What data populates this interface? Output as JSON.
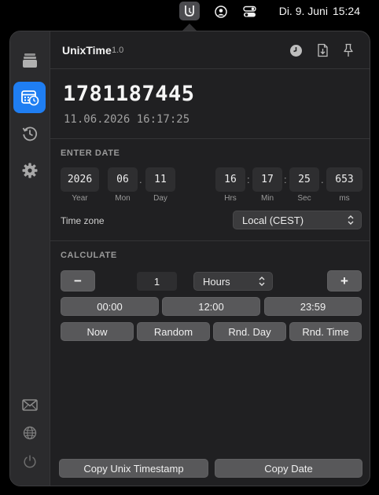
{
  "menubar": {
    "date": "Di. 9. Juni",
    "time": "15:24",
    "icons": [
      "unixtime-app-icon",
      "user-circle-icon",
      "control-center-icon"
    ]
  },
  "header": {
    "app_name": "UnixTime",
    "version": "1.0",
    "icons": [
      "clock-icon",
      "export-file-icon",
      "pin-icon"
    ]
  },
  "sidebar": {
    "items": [
      "layers-icon",
      "calendar-clock-icon",
      "history-icon",
      "gear-icon"
    ],
    "active": "calendar-clock-icon",
    "bottom_items": [
      "mail-icon",
      "globe-icon",
      "power-icon"
    ]
  },
  "timestamp": {
    "unix": "1781187445",
    "date_string": "11.06.2026 16:17:25"
  },
  "enter_date": {
    "title": "ENTER DATE",
    "year": {
      "value": "2026",
      "label": "Year"
    },
    "month": {
      "value": "06",
      "label": "Mon"
    },
    "day": {
      "value": "11",
      "label": "Day"
    },
    "hours": {
      "value": "16",
      "label": "Hrs"
    },
    "minutes": {
      "value": "17",
      "label": "Min"
    },
    "seconds": {
      "value": "25",
      "label": "Sec"
    },
    "ms": {
      "value": "653",
      "label": "ms"
    },
    "date_sep": ".",
    "time_sep": ":",
    "ms_sep": ".",
    "timezone_label": "Time zone",
    "timezone_value": "Local (CEST)"
  },
  "calculate": {
    "title": "CALCULATE",
    "minus": "−",
    "plus": "+",
    "amount": "1",
    "unit": "Hours",
    "time_buttons": [
      "00:00",
      "12:00",
      "23:59"
    ],
    "action_buttons": [
      "Now",
      "Random",
      "Rnd. Day",
      "Rnd. Time"
    ]
  },
  "footer": {
    "copy_unix": "Copy Unix Timestamp",
    "copy_date": "Copy Date"
  },
  "colors": {
    "accent": "#1f7ef2",
    "background": "#202022",
    "sidebar": "#2b2b2d",
    "button": "#58585a"
  }
}
